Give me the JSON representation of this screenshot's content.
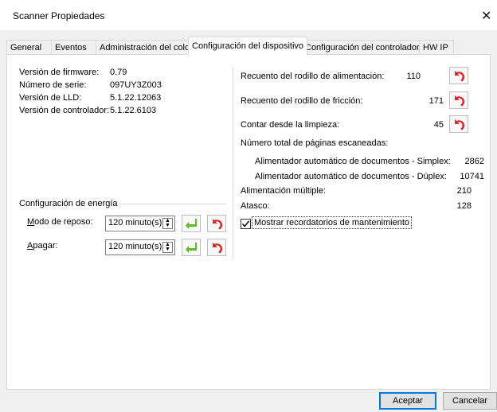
{
  "window": {
    "title": "Scanner Propiedades"
  },
  "tabs": [
    {
      "label": "General"
    },
    {
      "label": "Eventos"
    },
    {
      "label": "Administración del color"
    },
    {
      "label": "Configuración del dispositivo"
    },
    {
      "label": "Configuración del controlador"
    },
    {
      "label": "HW IP"
    }
  ],
  "info": [
    {
      "label": "Versión de firmware:",
      "value": "0.79"
    },
    {
      "label": "Número de serie:",
      "value": "097UY3Z003"
    },
    {
      "label": "Versión de LLD:",
      "value": "5.1.22.12063"
    },
    {
      "label": "Versión de controlador:",
      "value": "5.1.22.6103"
    }
  ],
  "energy": {
    "title": "Configuración de energía",
    "sleep": {
      "mnemonic": "M",
      "label_rest": "odo de reposo:",
      "value": "120 minuto(s)"
    },
    "off": {
      "mnemonic": "A",
      "label_rest": "pagar:",
      "value": "120 minuto(s)"
    }
  },
  "counters": [
    {
      "label": "Recuento del rodillo de alimentación:",
      "value": "110"
    },
    {
      "label": "Recuento del rodillo de fricción:",
      "value": "171"
    },
    {
      "label": "Contar desde la limpieza:",
      "value": "45"
    }
  ],
  "pages": {
    "title": "Número total de páginas escaneadas:",
    "simplex_label": "Alimentador automático de documentos - Simplex:",
    "simplex_value": "2862",
    "duplex_label": "Alimentador automático de documentos - Dúplex:",
    "duplex_value": "10741"
  },
  "multifeed": {
    "label": "Alimentación múltiple:",
    "value": "210"
  },
  "jam": {
    "label": "Atasco:",
    "value": "128"
  },
  "reminder": {
    "label": "Mostrar recordatorios de mantenimiento",
    "checked": true
  },
  "buttons": {
    "ok": "Aceptar",
    "cancel": "Cancelar"
  },
  "icons": {
    "apply": "green-apply-arrow-icon",
    "reset": "red-reset-arrow-icon"
  },
  "colors": {
    "apply": "#5fb82e",
    "reset": "#d8262b"
  }
}
